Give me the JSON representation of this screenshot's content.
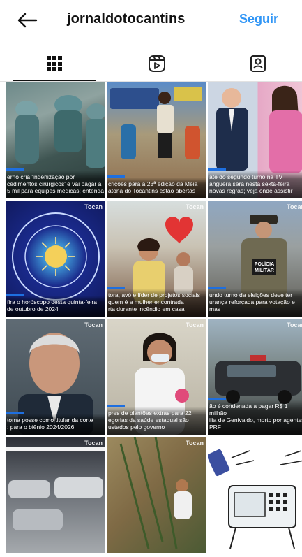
{
  "header": {
    "back_icon": "arrow-left-icon",
    "title": "jornaldotocantins",
    "follow_label": "Seguir",
    "follow_color": "#2f95f6"
  },
  "tabs": [
    {
      "icon": "grid-icon",
      "active": true
    },
    {
      "icon": "reels-icon",
      "active": false
    },
    {
      "icon": "tagged-icon",
      "active": false
    }
  ],
  "posts": [
    {
      "caption": "erno cria 'indenização por\ncedimentos cirúrgicos' e vai pagar a\n5 mil para equipes médicas; entenda"
    },
    {
      "caption": "crições para a 23ª edição da Meia\natona do Tocantins estão abertas"
    },
    {
      "caption": "ate do segundo turno na TV\nanguera será nesta sexta-feira\nnovas regras; veja onde assistir"
    },
    {
      "caption": "fira o horóscopo desta quinta-feira\nde outubro de 2024",
      "brand": "Tocan"
    },
    {
      "caption": "tora, avó e líder de projetos sociais\nquem é a mulher encontrada\nrta durante incêndio em casa",
      "brand": "Tocan"
    },
    {
      "caption": "undo turno da eleições deve ter\nurança reforçada para votação e\nmas",
      "brand": "Tocan"
    },
    {
      "caption": "toma posse como titular da corte\n: para o biênio 2024/2026",
      "brand": "Tocan"
    },
    {
      "caption": "pres de plantões extras para 22\negorias da saúde estadual são\nustados pelo governo",
      "brand": "Tocan"
    },
    {
      "caption": "ão é condenada a pagar R$ 1 milhão\nilia de Genivaldo, morto por agentes\nPRF",
      "brand": "Tocan"
    },
    {
      "caption": "",
      "brand": "Tocan"
    },
    {
      "caption": "",
      "brand": "Tocan"
    },
    {
      "caption": "",
      "brand": ""
    }
  ]
}
